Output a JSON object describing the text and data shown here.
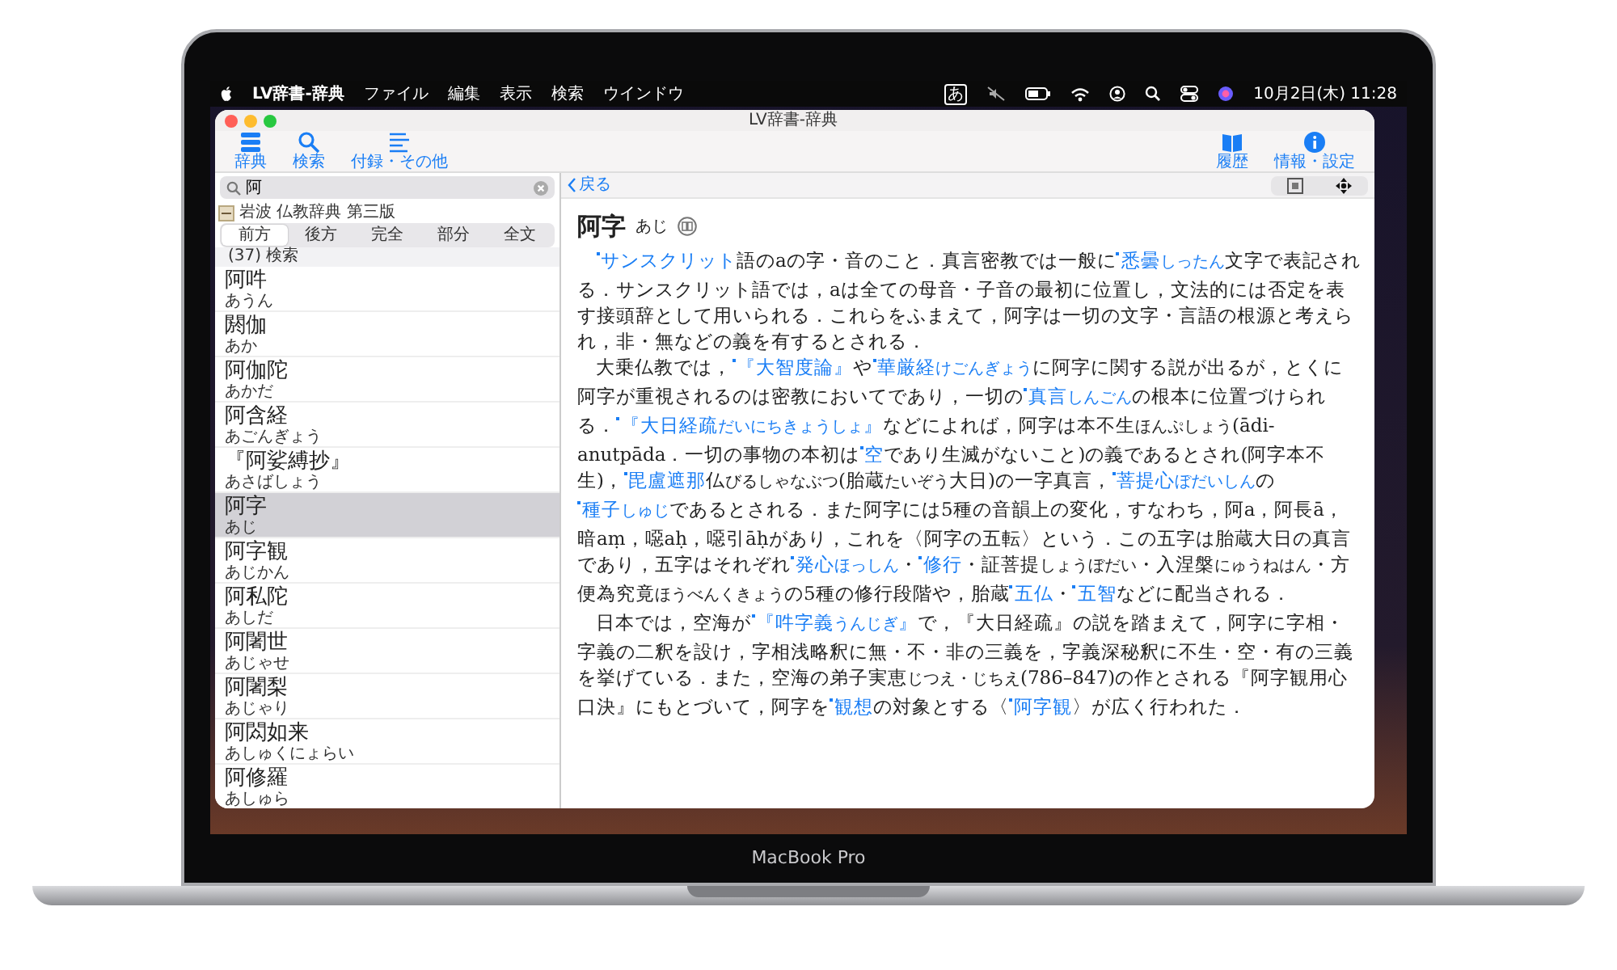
{
  "menu_bar": {
    "app": "LV辞書-辞典",
    "menus": [
      "ファイル",
      "編集",
      "表示",
      "検索",
      "ウインドウ"
    ],
    "input_mode": "あ",
    "clock": "10月2日(木) 11:28"
  },
  "window": {
    "title": "LV辞書-辞典"
  },
  "toolbar": {
    "left": [
      {
        "label": "辞典",
        "kind": "list"
      },
      {
        "label": "検索",
        "kind": "search"
      },
      {
        "label": "付録・その他",
        "kind": "lines"
      }
    ],
    "right": [
      {
        "label": "履歴",
        "kind": "book"
      },
      {
        "label": "情報・設定",
        "kind": "info"
      }
    ]
  },
  "search": {
    "value": "阿"
  },
  "dictionary": "岩波 仏教辞典 第三版",
  "match_modes": [
    {
      "label": "前方",
      "selected": true
    },
    {
      "label": "後方",
      "selected": false
    },
    {
      "label": "完全",
      "selected": false
    },
    {
      "label": "部分",
      "selected": false
    },
    {
      "label": "全文",
      "selected": false
    }
  ],
  "result_count": "(37) 検索",
  "results": [
    {
      "title": "阿吽",
      "reading": "あうん",
      "selected": false
    },
    {
      "title": "閼伽",
      "reading": "あか",
      "selected": false
    },
    {
      "title": "阿伽陀",
      "reading": "あかだ",
      "selected": false
    },
    {
      "title": "阿含経",
      "reading": "あごんぎょう",
      "selected": false
    },
    {
      "title": "『阿娑縛抄』",
      "reading": "あさばしょう",
      "selected": false
    },
    {
      "title": "阿字",
      "reading": "あじ",
      "selected": true
    },
    {
      "title": "阿字観",
      "reading": "あじかん",
      "selected": false
    },
    {
      "title": "阿私陀",
      "reading": "あしだ",
      "selected": false
    },
    {
      "title": "阿闍世",
      "reading": "あじゃせ",
      "selected": false
    },
    {
      "title": "阿闍梨",
      "reading": "あじゃり",
      "selected": false
    },
    {
      "title": "阿閦如来",
      "reading": "あしゅくにょらい",
      "selected": false
    },
    {
      "title": "阿修羅",
      "reading": "あしゅら",
      "selected": false
    }
  ],
  "nav": {
    "back": "戻る"
  },
  "entry": {
    "headword": "阿字",
    "reading": "あじ",
    "paragraphs": [
      [
        {
          "kind": "link",
          "t": "サンスクリット"
        },
        {
          "kind": "text",
          "t": "語のaの字・音のこと．真言密教では一般に"
        },
        {
          "kind": "link",
          "t": "悉曇",
          "reading": "しったん"
        },
        {
          "kind": "text",
          "t": "文字で表記される．サンスクリット語では，aは全ての母音・子音の最初に位置し，文法的には否定を表す接頭辞として用いられる．これらをふまえて，阿字は一切の文字・言語の根源と考えられ，非・無などの義を有するとされる．"
        }
      ],
      [
        {
          "kind": "text",
          "t": "大乗仏教では，"
        },
        {
          "kind": "link",
          "t": "『大智度論』"
        },
        {
          "kind": "text",
          "t": "や"
        },
        {
          "kind": "link",
          "t": "華厳経",
          "reading": "けごんぎょう"
        },
        {
          "kind": "text",
          "t": "に阿字に関する説が出るが，とくに阿字が重視されるのは密教においてであり，一切の"
        },
        {
          "kind": "link",
          "t": "真言",
          "reading": "しんごん"
        },
        {
          "kind": "text",
          "t": "の根本に位置づけられる．"
        },
        {
          "kind": "link",
          "t": "『大日経疏",
          "reading": "だいにちきょうしょ",
          "tail": "』"
        },
        {
          "kind": "text",
          "t": "などによれば，阿字は本不生",
          "reading": "ほんぷしょう"
        },
        {
          "kind": "text",
          "t": "(ādi-anutpāda．一切の事物の本初は"
        },
        {
          "kind": "link",
          "t": "空"
        },
        {
          "kind": "text",
          "t": "であり生滅がないこと)の義であるとされ(阿字本不生)，"
        },
        {
          "kind": "link",
          "t": "毘盧遮那"
        },
        {
          "kind": "text",
          "t": "仏",
          "reading": "びるしゃなぶつ"
        },
        {
          "kind": "text",
          "t": "(胎蔵",
          "reading": "たいぞう"
        },
        {
          "kind": "text",
          "t": "大日)の一字真言，"
        },
        {
          "kind": "link",
          "t": "菩提心",
          "reading": "ぼだいしん"
        },
        {
          "kind": "text",
          "t": "の"
        },
        {
          "kind": "link",
          "t": "種子",
          "reading": "しゅじ"
        },
        {
          "kind": "text",
          "t": "であるとされる．また阿字には5種の音韻上の変化，すなわち，阿a，阿長ā，暗aṃ，噁aḥ，噁引āḥがあり，これを〈阿字の五転〉という．この五字は胎蔵大日の真言であり，五字はそれぞれ"
        },
        {
          "kind": "link",
          "t": "発心",
          "reading": "ほっしん"
        },
        {
          "kind": "text",
          "t": "・"
        },
        {
          "kind": "link",
          "t": "修行"
        },
        {
          "kind": "text",
          "t": "・証菩提",
          "reading": "しょうぼだい"
        },
        {
          "kind": "text",
          "t": "・入涅槃",
          "reading": "にゅうねはん"
        },
        {
          "kind": "text",
          "t": "・方便為究竟",
          "reading": "ほうべんくきょう"
        },
        {
          "kind": "text",
          "t": "の5種の修行段階や，胎蔵"
        },
        {
          "kind": "link",
          "t": "五仏"
        },
        {
          "kind": "text",
          "t": "・"
        },
        {
          "kind": "link",
          "t": "五智"
        },
        {
          "kind": "text",
          "t": "などに配当される．"
        }
      ],
      [
        {
          "kind": "text",
          "t": "日本では，空海が"
        },
        {
          "kind": "link",
          "t": "『吽字義",
          "reading": "うんじぎ",
          "tail": "』"
        },
        {
          "kind": "text",
          "t": "で，『大日経疏』の説を踏まえて，阿字に字相・字義の二釈を設け，字相浅略釈に無・不・非の三義を，字義深秘釈に不生・空・有の三義を挙げている．また，空海の弟子実恵",
          "reading": "じつえ・じちえ"
        },
        {
          "kind": "text",
          "t": "(786–847)の作とされる『阿字観用心口決』にもとづいて，阿字を"
        },
        {
          "kind": "link",
          "t": "観想"
        },
        {
          "kind": "text",
          "t": "の対象とする〈"
        },
        {
          "kind": "link",
          "t": "阿字観"
        },
        {
          "kind": "text",
          "t": "〉が広く行われた．"
        }
      ]
    ]
  },
  "device_label": "MacBook Pro"
}
